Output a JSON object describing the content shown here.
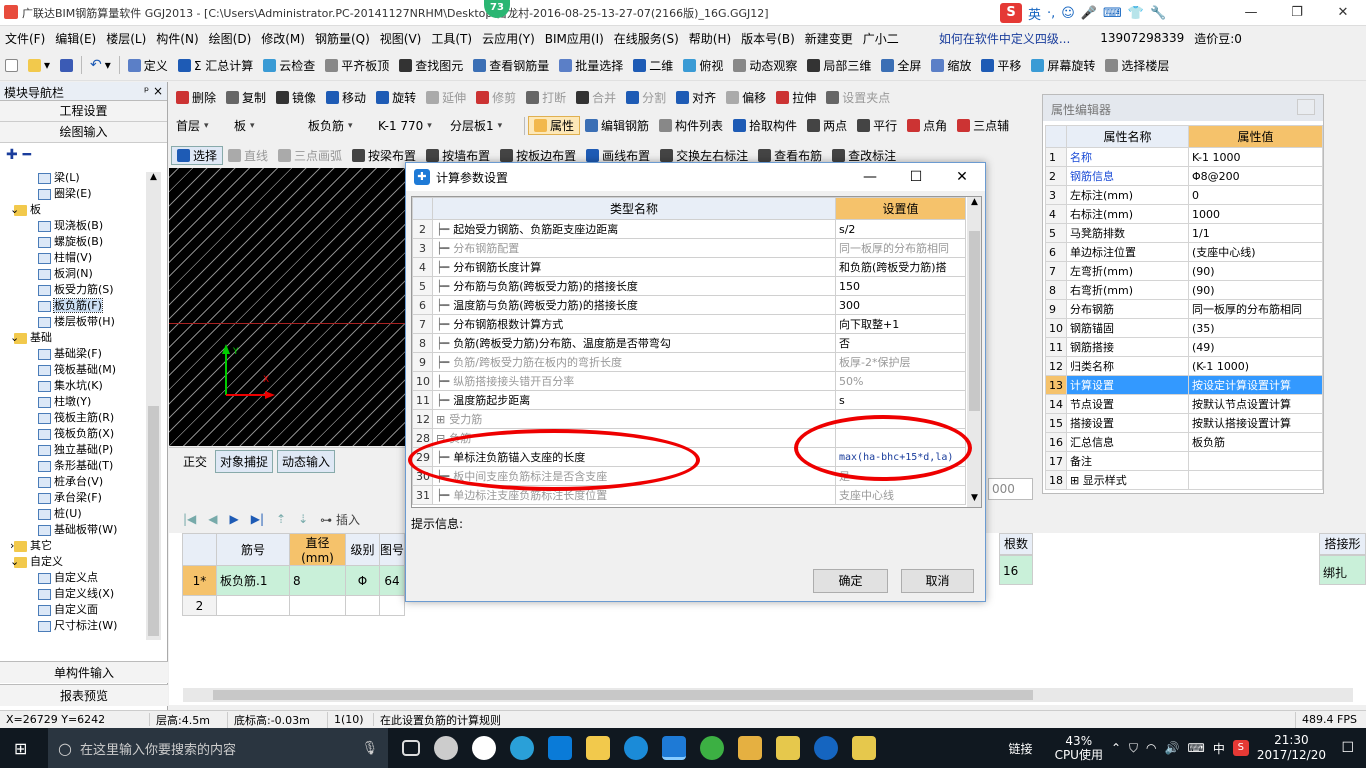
{
  "titlebar": {
    "title": "广联达BIM钢筋算量软件 GGJ2013 - [C:\\Users\\Administrator.PC-20141127NRHM\\Desktop\\白龙村-2016-08-25-13-27-07(2166版)_16G.GGJ12]",
    "badge": "73",
    "ime": {
      "s": "S",
      "lang": "英"
    },
    "controls": [
      "—",
      "❐",
      "✕"
    ]
  },
  "menubar": {
    "items": [
      "文件(F)",
      "编辑(E)",
      "楼层(L)",
      "构件(N)",
      "绘图(D)",
      "修改(M)",
      "钢筋量(Q)",
      "视图(V)",
      "工具(T)",
      "云应用(Y)",
      "BIM应用(I)",
      "在线服务(S)",
      "帮助(H)",
      "版本号(B)",
      "新建变更",
      "广小二",
      "如何在软件中定义四级...",
      "13907298339",
      "造价豆:0"
    ]
  },
  "toolbar1": {
    "items": [
      "定义",
      "Σ 汇总计算",
      "云检查",
      "平齐板顶",
      "查找图元",
      "查看钢筋量",
      "批量选择",
      "二维",
      "俯视",
      "动态观察",
      "局部三维",
      "全屏",
      "缩放",
      "平移",
      "屏幕旋转",
      "选择楼层"
    ]
  },
  "toolbar2": {
    "items": [
      "删除",
      "复制",
      "镜像",
      "移动",
      "旋转",
      "延伸",
      "修剪",
      "打断",
      "合并",
      "分割",
      "对齐",
      "偏移",
      "拉伸",
      "设置夹点"
    ]
  },
  "toolbar3": {
    "floor": "首层",
    "category": "板",
    "type": "板负筋",
    "member": "K-1 770",
    "layer": "分层板1",
    "items": [
      "属性",
      "编辑钢筋",
      "构件列表",
      "拾取构件",
      "两点",
      "平行",
      "点角",
      "三点辅"
    ]
  },
  "toolbar4": {
    "items": [
      "选择",
      "直线",
      "三点画弧",
      "按梁布置",
      "按墙布置",
      "按板边布置",
      "画线布置",
      "交换左右标注",
      "查看布筋",
      "查改标注"
    ]
  },
  "nav": {
    "title": "模块导航栏",
    "pin": "ᵖ ×",
    "tabs": [
      "工程设置",
      "绘图输入"
    ],
    "tree": [
      {
        "label": "梁(L)",
        "indent": 3,
        "type": "item"
      },
      {
        "label": "圈梁(E)",
        "indent": 3,
        "type": "item"
      },
      {
        "label": "板",
        "indent": 1,
        "type": "folder",
        "exp": "⊟"
      },
      {
        "label": "现浇板(B)",
        "indent": 3,
        "type": "item"
      },
      {
        "label": "螺旋板(B)",
        "indent": 3,
        "type": "item"
      },
      {
        "label": "柱帽(V)",
        "indent": 3,
        "type": "item"
      },
      {
        "label": "板洞(N)",
        "indent": 3,
        "type": "item"
      },
      {
        "label": "板受力筋(S)",
        "indent": 3,
        "type": "item"
      },
      {
        "label": "板负筋(F)",
        "indent": 3,
        "type": "item",
        "selected": true
      },
      {
        "label": "楼层板带(H)",
        "indent": 3,
        "type": "item"
      },
      {
        "label": "基础",
        "indent": 1,
        "type": "folder",
        "exp": "⊟"
      },
      {
        "label": "基础梁(F)",
        "indent": 3,
        "type": "item"
      },
      {
        "label": "筏板基础(M)",
        "indent": 3,
        "type": "item"
      },
      {
        "label": "集水坑(K)",
        "indent": 3,
        "type": "item"
      },
      {
        "label": "柱墩(Y)",
        "indent": 3,
        "type": "item"
      },
      {
        "label": "筏板主筋(R)",
        "indent": 3,
        "type": "item"
      },
      {
        "label": "筏板负筋(X)",
        "indent": 3,
        "type": "item"
      },
      {
        "label": "独立基础(P)",
        "indent": 3,
        "type": "item"
      },
      {
        "label": "条形基础(T)",
        "indent": 3,
        "type": "item"
      },
      {
        "label": "桩承台(V)",
        "indent": 3,
        "type": "item"
      },
      {
        "label": "承台梁(F)",
        "indent": 3,
        "type": "item"
      },
      {
        "label": "桩(U)",
        "indent": 3,
        "type": "item"
      },
      {
        "label": "基础板带(W)",
        "indent": 3,
        "type": "item"
      },
      {
        "label": "其它",
        "indent": 1,
        "type": "folder",
        "exp": "⊞"
      },
      {
        "label": "自定义",
        "indent": 1,
        "type": "folder",
        "exp": "⊟"
      },
      {
        "label": "自定义点",
        "indent": 3,
        "type": "item"
      },
      {
        "label": "自定义线(X)",
        "indent": 3,
        "type": "item"
      },
      {
        "label": "自定义面",
        "indent": 3,
        "type": "item"
      },
      {
        "label": "尺寸标注(W)",
        "indent": 3,
        "type": "item"
      }
    ],
    "bottom_tabs": [
      "单构件输入",
      "报表预览"
    ]
  },
  "canvas_toolbar": {
    "items": [
      "正交",
      "对象捕捉",
      "动态输入"
    ],
    "coord_val": "000"
  },
  "dialog": {
    "title": "计算参数设置",
    "col_name": "类型名称",
    "col_value": "设置值",
    "rows": [
      {
        "n": "2",
        "name": "起始受力钢筋、负筋距支座边距离",
        "value": "s/2",
        "grey": false,
        "tree": "line"
      },
      {
        "n": "3",
        "name": "分布钢筋配置",
        "value": "同一板厚的分布筋相同",
        "grey": true,
        "tree": "line"
      },
      {
        "n": "4",
        "name": "分布钢筋长度计算",
        "value": "和负筋(跨板受力筋)搭",
        "grey": false,
        "tree": "line"
      },
      {
        "n": "5",
        "name": "分布筋与负筋(跨板受力筋)的搭接长度",
        "value": "150",
        "grey": false,
        "tree": "line"
      },
      {
        "n": "6",
        "name": "温度筋与负筋(跨板受力筋)的搭接长度",
        "value": "300",
        "grey": false,
        "tree": "line"
      },
      {
        "n": "7",
        "name": "分布钢筋根数计算方式",
        "value": "向下取整+1",
        "grey": false,
        "tree": "line"
      },
      {
        "n": "8",
        "name": "负筋(跨板受力筋)分布筋、温度筋是否带弯勾",
        "value": "否",
        "grey": false,
        "tree": "line"
      },
      {
        "n": "9",
        "name": "负筋/跨板受力筋在板内的弯折长度",
        "value": "板厚-2*保护层",
        "grey": true,
        "tree": "line"
      },
      {
        "n": "10",
        "name": "纵筋搭接接头错开百分率",
        "value": "50%",
        "grey": true,
        "tree": "line"
      },
      {
        "n": "11",
        "name": "温度筋起步距离",
        "value": "s",
        "grey": false,
        "tree": "line"
      },
      {
        "n": "12",
        "name": "受力筋",
        "value": "",
        "grey": true,
        "tree": "plus"
      },
      {
        "n": "28",
        "name": "负筋",
        "value": "",
        "grey": true,
        "tree": "minus"
      },
      {
        "n": "29",
        "name": "单标注负筋锚入支座的长度",
        "value": "max(ha-bhc+15*d,la)",
        "grey": false,
        "tree": "line",
        "blue": true
      },
      {
        "n": "30",
        "name": "板中间支座负筋标注是否含支座",
        "value": "是",
        "grey": true,
        "tree": "line"
      },
      {
        "n": "31",
        "name": "单边标注支座负筋标注长度位置",
        "value": "支座中心线",
        "grey": true,
        "tree": "line"
      }
    ],
    "hint_label": "提示信息:",
    "ok": "确定",
    "cancel": "取消",
    "controls": [
      "—",
      "☐",
      "✕"
    ]
  },
  "property_editor": {
    "title": "属性编辑器",
    "col_name": "属性名称",
    "col_value": "属性值",
    "rows": [
      {
        "n": "1",
        "name": "名称",
        "value": "K-1 1000",
        "blue": true
      },
      {
        "n": "2",
        "name": "钢筋信息",
        "value": "Φ8@200",
        "blue": true
      },
      {
        "n": "3",
        "name": "左标注(mm)",
        "value": "0",
        "blue": false
      },
      {
        "n": "4",
        "name": "右标注(mm)",
        "value": "1000",
        "blue": false
      },
      {
        "n": "5",
        "name": "马凳筋排数",
        "value": "1/1",
        "blue": false
      },
      {
        "n": "6",
        "name": "单边标注位置",
        "value": "(支座中心线)",
        "blue": false
      },
      {
        "n": "7",
        "name": "左弯折(mm)",
        "value": "(90)",
        "blue": false
      },
      {
        "n": "8",
        "name": "右弯折(mm)",
        "value": "(90)",
        "blue": false
      },
      {
        "n": "9",
        "name": "分布钢筋",
        "value": "同一板厚的分布筋相同",
        "blue": false
      },
      {
        "n": "10",
        "name": "钢筋锚固",
        "value": "(35)",
        "blue": false
      },
      {
        "n": "11",
        "name": "钢筋搭接",
        "value": "(49)",
        "blue": false
      },
      {
        "n": "12",
        "name": "归类名称",
        "value": "(K-1 1000)",
        "blue": false
      },
      {
        "n": "13",
        "name": "计算设置",
        "value": "按设定计算设置计算",
        "blue": false,
        "highlight": true
      },
      {
        "n": "14",
        "name": "节点设置",
        "value": "按默认节点设置计算",
        "blue": false
      },
      {
        "n": "15",
        "name": "搭接设置",
        "value": "按默认搭接设置计算",
        "blue": false
      },
      {
        "n": "16",
        "name": "汇总信息",
        "value": "板负筋",
        "blue": false
      },
      {
        "n": "17",
        "name": "备注",
        "value": "",
        "blue": false
      },
      {
        "n": "18",
        "name": "显示样式",
        "value": "",
        "blue": false,
        "plus": true
      }
    ]
  },
  "bottom_grid": {
    "toolbar": [
      "插入"
    ],
    "headers": [
      "筋号",
      "直径(mm)",
      "级别",
      "图号"
    ],
    "rows": [
      {
        "n": "1*",
        "name": "板负筋.1",
        "dia": "8",
        "grade": "Φ",
        "fig": "64"
      },
      {
        "n": "2",
        "name": "",
        "dia": "",
        "grade": "",
        "fig": ""
      }
    ],
    "right_headers": [
      "根数",
      "搭接形"
    ],
    "right_row": {
      "count": "16",
      "lap": "绑扎"
    }
  },
  "statusbar": {
    "coords": "X=26729 Y=6242",
    "floor_h": "层高:4.5m",
    "bottom_h": "底标高:-0.03m",
    "count": "1(10)",
    "hint": "在此设置负筋的计算规则",
    "fps": "489.4 FPS"
  },
  "taskbar": {
    "search": "在这里输入你要搜索的内容",
    "link": "链接",
    "cpu_pct": "43%",
    "cpu_label": "CPU使用",
    "ime": "中",
    "time": "21:30",
    "date": "2017/12/20"
  },
  "colors": {
    "accent": "#3399ff",
    "header_value": "#f5c26b",
    "annotation": "#e00000",
    "taskbar": "#101820"
  }
}
